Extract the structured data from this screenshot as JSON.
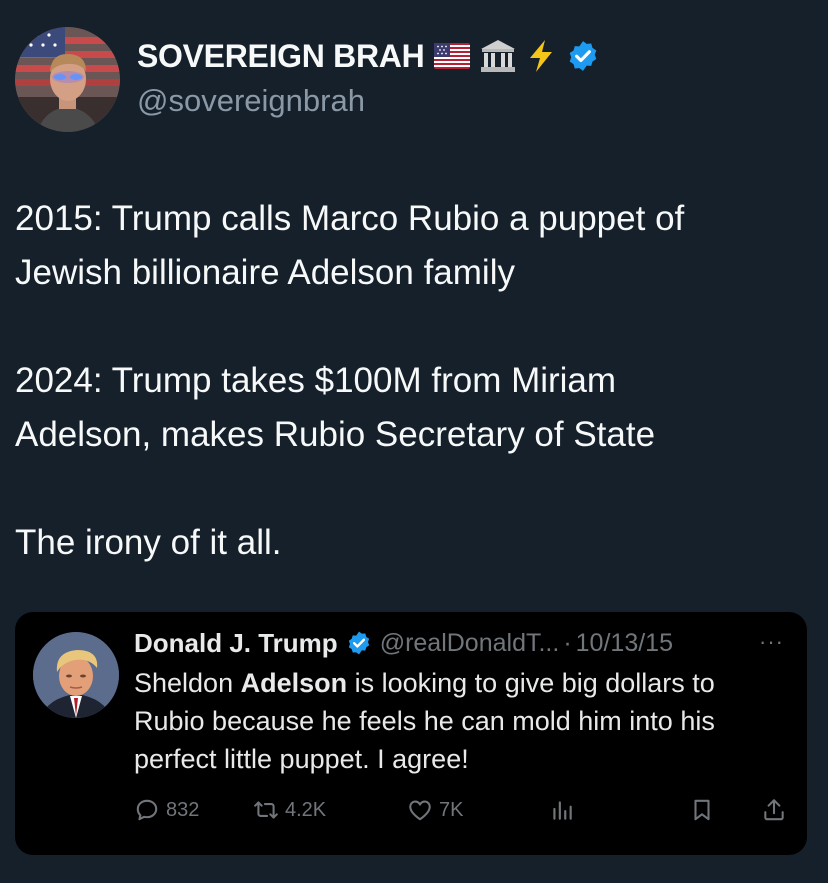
{
  "author": {
    "display_name": "SOVEREIGN BRAH",
    "handle": "@sovereignbrah",
    "badges": [
      "us-flag-emoji",
      "classical-building-emoji",
      "lightning-emoji",
      "verified-badge"
    ]
  },
  "tweet": {
    "paragraphs": [
      [
        "2015: Trump calls Marco Rubio a puppet of",
        "Jewish billionaire Adelson family"
      ],
      [
        "2024: Trump takes $100M from Miriam",
        "Adelson, makes Rubio Secretary of State"
      ],
      [
        "The irony of it all."
      ]
    ]
  },
  "quoted_tweet": {
    "display_name": "Donald J. Trump",
    "handle": "@realDonaldT...",
    "separator": "·",
    "date": "10/13/15",
    "more": "···",
    "text_before": "Sheldon ",
    "text_bold": "Adelson",
    "text_after": " is looking to give big dollars to Rubio because he feels he can mold him into his perfect little puppet. I agree!",
    "metrics": {
      "replies": "832",
      "retweets": "4.2K",
      "likes": "7K"
    }
  },
  "colors": {
    "background": "#15202b",
    "quote_background": "#000000",
    "verified": "#1d9bf0",
    "muted": "#71767b"
  }
}
